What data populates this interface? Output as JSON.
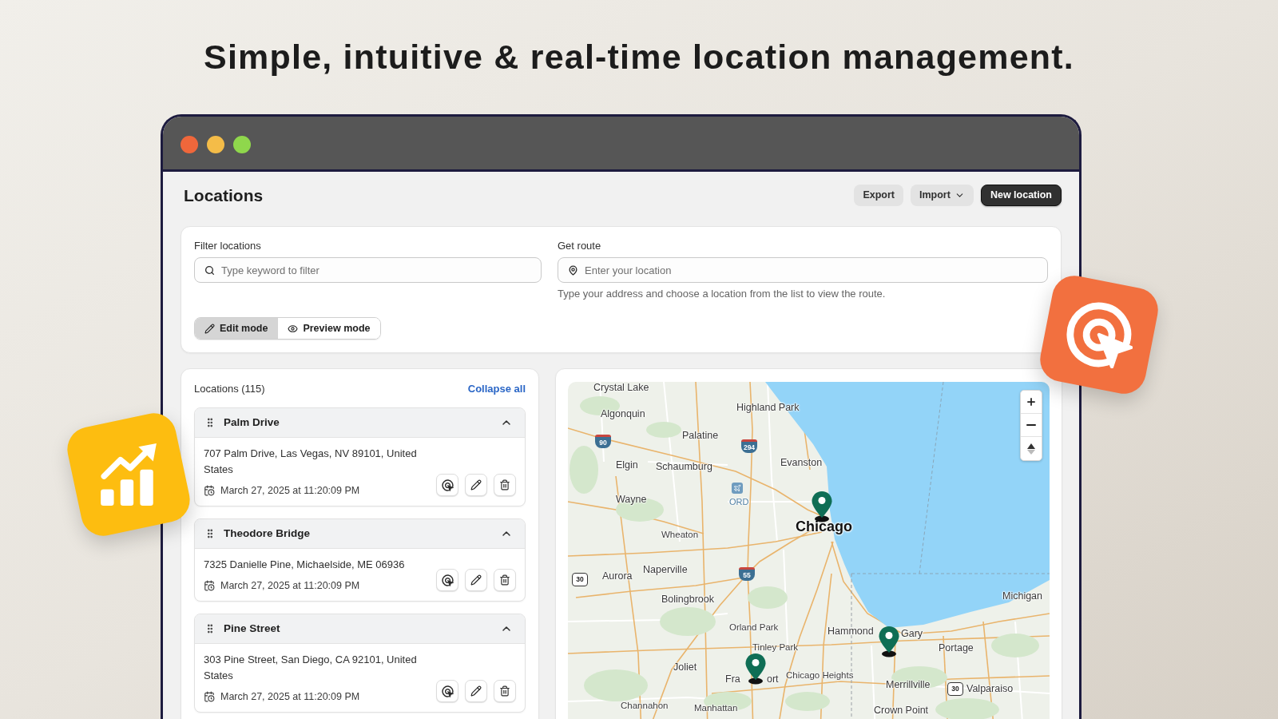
{
  "headline": "Simple, intuitive & real-time location management.",
  "window": {
    "buttons": [
      {
        "color": "#ef673b"
      },
      {
        "color": "#f4bc48"
      },
      {
        "color": "#8fd74c"
      }
    ]
  },
  "page": {
    "title": "Locations",
    "actions": [
      {
        "kind": "secondary",
        "label": "Export"
      },
      {
        "kind": "menu",
        "label": "Import"
      },
      {
        "kind": "primary",
        "label": "New location"
      }
    ]
  },
  "filters": {
    "filter": {
      "label": "Filter locations",
      "placeholder": "Type keyword to filter"
    },
    "route": {
      "label": "Get route",
      "placeholder": "Enter your location",
      "help": "Type your address and choose a location from the list to view the route."
    },
    "modes": [
      {
        "kind": "edit",
        "label": "Edit mode",
        "selected": true
      },
      {
        "kind": "preview",
        "label": "Preview mode",
        "selected": false
      }
    ]
  },
  "locations": {
    "title": "Locations (115)",
    "collapse_link": "Collapse all",
    "items": [
      {
        "name": "Palm Drive",
        "expanded": true,
        "address": "707 Palm Drive, Las Vegas, NV 89101, United States",
        "timestamp": "March 27, 2025 at 11:20:09 PM"
      },
      {
        "name": "Theodore Bridge",
        "expanded": true,
        "address": "7325 Danielle Pine, Michaelside, ME 06936",
        "timestamp": "March 27, 2025 at 11:20:09 PM"
      },
      {
        "name": "Pine Street",
        "expanded": true,
        "address": "303 Pine Street, San Diego, CA 92101, United States",
        "timestamp": "March 27, 2025 at 11:20:09 PM"
      }
    ]
  },
  "map": {
    "labels": [
      {
        "text": "Crystal Lake",
        "kind": "city"
      },
      {
        "text": "Algonquin",
        "kind": "city"
      },
      {
        "text": "Highland Park",
        "kind": "city"
      },
      {
        "text": "Palatine",
        "kind": "city"
      },
      {
        "text": "Elgin",
        "kind": "city"
      },
      {
        "text": "Schaumburg",
        "kind": "city"
      },
      {
        "text": "Evanston",
        "kind": "city"
      },
      {
        "text": "Wayne",
        "kind": "city"
      },
      {
        "text": "ORD",
        "kind": "airport"
      },
      {
        "text": "Wheaton",
        "kind": "small"
      },
      {
        "text": "Chicago",
        "kind": "major"
      },
      {
        "text": "Aurora",
        "kind": "city"
      },
      {
        "text": "Naperville",
        "kind": "city"
      },
      {
        "text": "Bolingbrook",
        "kind": "city"
      },
      {
        "text": "Michigan",
        "kind": "city"
      },
      {
        "text": "Orland Park",
        "kind": "small"
      },
      {
        "text": "Hammond",
        "kind": "city"
      },
      {
        "text": "Gary",
        "kind": "city"
      },
      {
        "text": "Tinley Park",
        "kind": "small"
      },
      {
        "text": "Portage",
        "kind": "city"
      },
      {
        "text": "Joliet",
        "kind": "city"
      },
      {
        "text": "Fra",
        "kind": "city"
      },
      {
        "text": "ort",
        "kind": "city"
      },
      {
        "text": "Chicago Heights",
        "kind": "small"
      },
      {
        "text": "Merrillville",
        "kind": "city"
      },
      {
        "text": "Valparaiso",
        "kind": "city"
      },
      {
        "text": "Channahon",
        "kind": "small"
      },
      {
        "text": "Manhattan",
        "kind": "small"
      },
      {
        "text": "Crown Point",
        "kind": "city"
      }
    ],
    "shields": [
      {
        "kind": "interstate",
        "number": "90"
      },
      {
        "kind": "interstate",
        "number": "294"
      },
      {
        "kind": "us",
        "number": "30"
      },
      {
        "kind": "interstate",
        "number": "55"
      },
      {
        "kind": "us",
        "number": "30"
      }
    ]
  }
}
